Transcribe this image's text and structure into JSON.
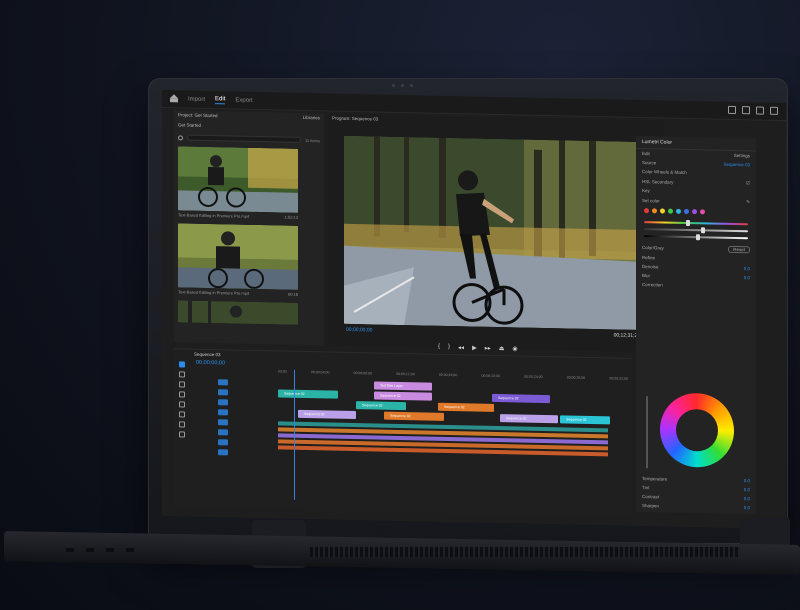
{
  "app": {
    "nav_tabs": [
      "Import",
      "Edit",
      "Export"
    ],
    "active_tab": "Edit"
  },
  "project_panel": {
    "title": "Project: Get Started",
    "subtitle": "Get Started",
    "items_count": "11 Items",
    "libraries_label": "Libraries",
    "clips": [
      {
        "label": "Text-Based Editing in Premiere Pro.mp4",
        "duration": "1:53:13"
      },
      {
        "label": "Text-Based Editing in Premiere Pro.mp4",
        "duration": "00:18"
      }
    ]
  },
  "program_monitor": {
    "title": "Program: Sequence 03",
    "fit": "Fit",
    "timecode_left": "00;00;00;00",
    "timecode_right": "00;12;31;21",
    "zoom": "1/2"
  },
  "lumetri": {
    "title": "Lumetri Color",
    "tabs": [
      "Edit",
      "Settings"
    ],
    "source_label": "Source",
    "sequence_label": "Sequence 03",
    "section": "Color Wheels & Match",
    "hsl": "HSL Secondary",
    "key": "Key",
    "set_color": "Set color",
    "color_gray": "Color/Gray",
    "reset": "Reset",
    "refine": "Refine",
    "denoise": "Denoise",
    "blur": "Blur",
    "correction": "Correction",
    "temperature": "Temperature",
    "tint": "Tint",
    "contrast": "Contrast",
    "sharpen": "Sharpen",
    "swatch_colors": [
      "#e03a3a",
      "#f08a24",
      "#f2d12a",
      "#3fc94a",
      "#2fb6d9",
      "#3e6fe0",
      "#9b4fe0",
      "#e04fa9"
    ]
  },
  "timeline": {
    "title": "Sequence 03",
    "timecode": "00;00;00;00",
    "ruler": [
      "00;00",
      "00;00;04;00",
      "00;00;08;00",
      "00;00;12;00",
      "00;00;16;00",
      "00;00;20;00",
      "00;00;24;00",
      "00;00;28;00",
      "00;00;32;00"
    ],
    "video_clips": [
      {
        "label": "Ted Title Layer",
        "color": "#c88be0"
      },
      {
        "label": "Sequence 02",
        "color": "#2bb3a8"
      },
      {
        "label": "Sequence 02",
        "color": "#c88be0"
      },
      {
        "label": "Sequence 02",
        "color": "#7b5ad6"
      },
      {
        "label": "Sequence 02",
        "color": "#2bb3a8"
      },
      {
        "label": "Sequence 02",
        "color": "#e07a2a"
      },
      {
        "label": "Sequence 02",
        "color": "#b9a0e8"
      },
      {
        "label": "Sequence 02",
        "color": "#e07a2a"
      },
      {
        "label": "Sequence 02",
        "color": "#b9a0e8"
      },
      {
        "label": "Sequence 02",
        "color": "#2bc4d6"
      }
    ]
  }
}
